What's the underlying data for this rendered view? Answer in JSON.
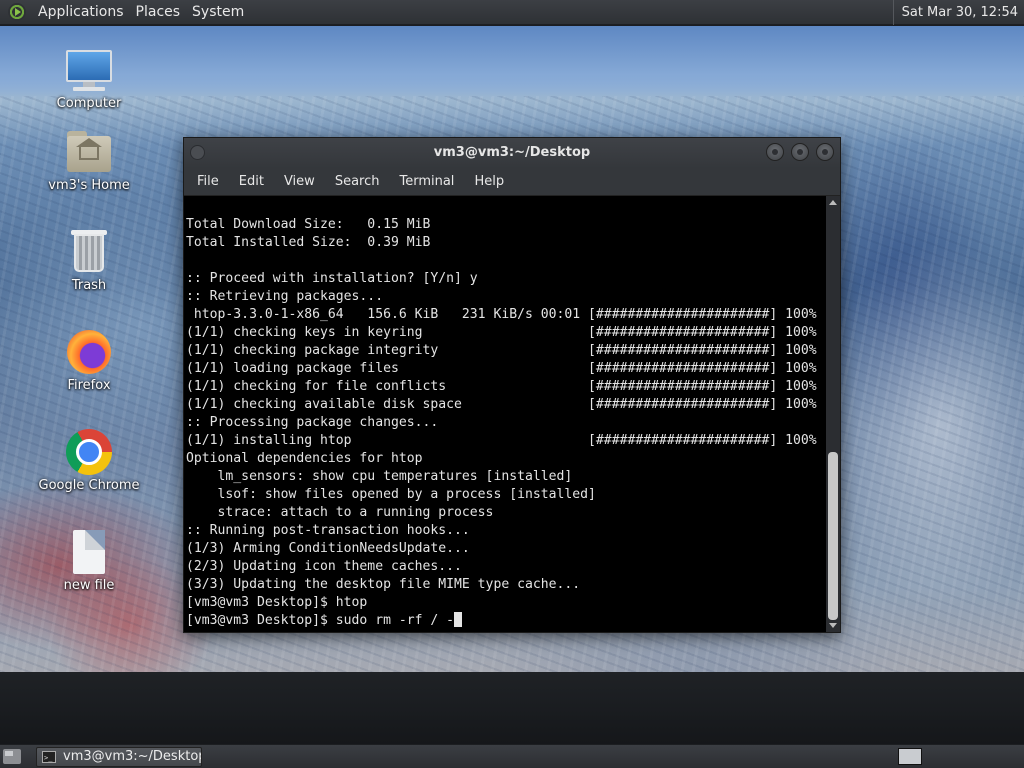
{
  "top_panel": {
    "menus": [
      "Applications",
      "Places",
      "System"
    ],
    "clock": "Sat Mar 30, 12:54"
  },
  "desktop_icons": [
    {
      "label": "Computer",
      "icon": "computer-icon"
    },
    {
      "label": "vm3's Home",
      "icon": "home-folder-icon"
    },
    {
      "label": "Trash",
      "icon": "trash-icon"
    },
    {
      "label": "Firefox",
      "icon": "firefox-icon"
    },
    {
      "label": "Google Chrome",
      "icon": "chrome-icon"
    },
    {
      "label": "new file",
      "icon": "file-icon"
    }
  ],
  "terminal": {
    "title": "vm3@vm3:~/Desktop",
    "menu": [
      "File",
      "Edit",
      "View",
      "Search",
      "Terminal",
      "Help"
    ],
    "lines": [
      "Total Download Size:   0.15 MiB",
      "Total Installed Size:  0.39 MiB",
      "",
      ":: Proceed with installation? [Y/n] y",
      ":: Retrieving packages...",
      " htop-3.3.0-1-x86_64   156.6 KiB   231 KiB/s 00:01 [######################] 100%",
      "(1/1) checking keys in keyring                     [######################] 100%",
      "(1/1) checking package integrity                   [######################] 100%",
      "(1/1) loading package files                        [######################] 100%",
      "(1/1) checking for file conflicts                  [######################] 100%",
      "(1/1) checking available disk space                [######################] 100%",
      ":: Processing package changes...",
      "(1/1) installing htop                              [######################] 100%",
      "Optional dependencies for htop",
      "    lm_sensors: show cpu temperatures [installed]",
      "    lsof: show files opened by a process [installed]",
      "    strace: attach to a running process",
      ":: Running post-transaction hooks...",
      "(1/3) Arming ConditionNeedsUpdate...",
      "(2/3) Updating icon theme caches...",
      "(3/3) Updating the desktop file MIME type cache...",
      "[vm3@vm3 Desktop]$ htop",
      "[vm3@vm3 Desktop]$ sudo rm -rf / -"
    ]
  },
  "taskbar": {
    "window_button": "vm3@vm3:~/Desktop"
  }
}
